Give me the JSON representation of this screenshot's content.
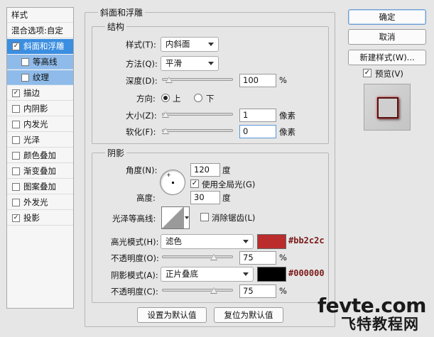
{
  "style_panel": {
    "header": "样式",
    "items": [
      {
        "label": "混合选项:自定",
        "checkbox": false,
        "checked": false,
        "state": "normal"
      },
      {
        "label": "斜面和浮雕",
        "checkbox": true,
        "checked": true,
        "state": "selected"
      },
      {
        "label": "等高线",
        "checkbox": true,
        "checked": false,
        "state": "sub"
      },
      {
        "label": "纹理",
        "checkbox": true,
        "checked": false,
        "state": "sub"
      },
      {
        "label": "描边",
        "checkbox": true,
        "checked": true,
        "state": "normal"
      },
      {
        "label": "内阴影",
        "checkbox": true,
        "checked": false,
        "state": "normal"
      },
      {
        "label": "内发光",
        "checkbox": true,
        "checked": false,
        "state": "normal"
      },
      {
        "label": "光泽",
        "checkbox": true,
        "checked": false,
        "state": "normal"
      },
      {
        "label": "颜色叠加",
        "checkbox": true,
        "checked": false,
        "state": "normal"
      },
      {
        "label": "渐变叠加",
        "checkbox": true,
        "checked": false,
        "state": "normal"
      },
      {
        "label": "图案叠加",
        "checkbox": true,
        "checked": false,
        "state": "normal"
      },
      {
        "label": "外发光",
        "checkbox": true,
        "checked": false,
        "state": "normal"
      },
      {
        "label": "投影",
        "checkbox": true,
        "checked": true,
        "state": "normal"
      }
    ]
  },
  "bevel": {
    "title": "斜面和浮雕",
    "structure": {
      "title": "结构",
      "style_label": "样式(T):",
      "style_value": "内斜面",
      "technique_label": "方法(Q):",
      "technique_value": "平滑",
      "depth_label": "深度(D):",
      "depth_value": "100",
      "depth_unit": "%",
      "depth_slider_fraction": 0.05,
      "direction_label": "方向:",
      "direction_up": "上",
      "direction_down": "下",
      "direction_selected": "上",
      "size_label": "大小(Z):",
      "size_value": "1",
      "size_unit": "像素",
      "size_slider_fraction": 0.0,
      "soften_label": "软化(F):",
      "soften_value": "0",
      "soften_unit": "像素",
      "soften_slider_fraction": 0.0
    },
    "shading": {
      "title": "阴影",
      "angle_label": "角度(N):",
      "angle_value": "120",
      "angle_unit": "度",
      "global_light_label": "使用全局光(G)",
      "global_light_checked": true,
      "altitude_label": "高度:",
      "altitude_value": "30",
      "altitude_unit": "度",
      "gloss_contour_label": "光泽等高线:",
      "anti_aliased_label": "消除锯齿(L)",
      "anti_aliased_checked": false,
      "highlight_mode_label": "高光模式(H):",
      "highlight_mode_value": "滤色",
      "highlight_color": "#bb2c2c",
      "highlight_color_text": "#bb2c2c",
      "highlight_opacity_label": "不透明度(O):",
      "highlight_opacity_value": "75",
      "highlight_opacity_unit": "%",
      "highlight_opacity_fraction": 0.75,
      "shadow_mode_label": "阴影模式(A):",
      "shadow_mode_value": "正片叠底",
      "shadow_color": "#000000",
      "shadow_color_text": "#000000",
      "shadow_opacity_label": "不透明度(C):",
      "shadow_opacity_value": "75",
      "shadow_opacity_unit": "%",
      "shadow_opacity_fraction": 0.75
    },
    "make_default": "设置为默认值",
    "reset_default": "复位为默认值"
  },
  "buttons": {
    "ok": "确定",
    "cancel": "取消",
    "new_style": "新建样式(W)...",
    "preview_label": "预览(V)",
    "preview_checked": true
  },
  "watermark": {
    "line1": "fevte.com",
    "line2": "飞特教程网"
  }
}
